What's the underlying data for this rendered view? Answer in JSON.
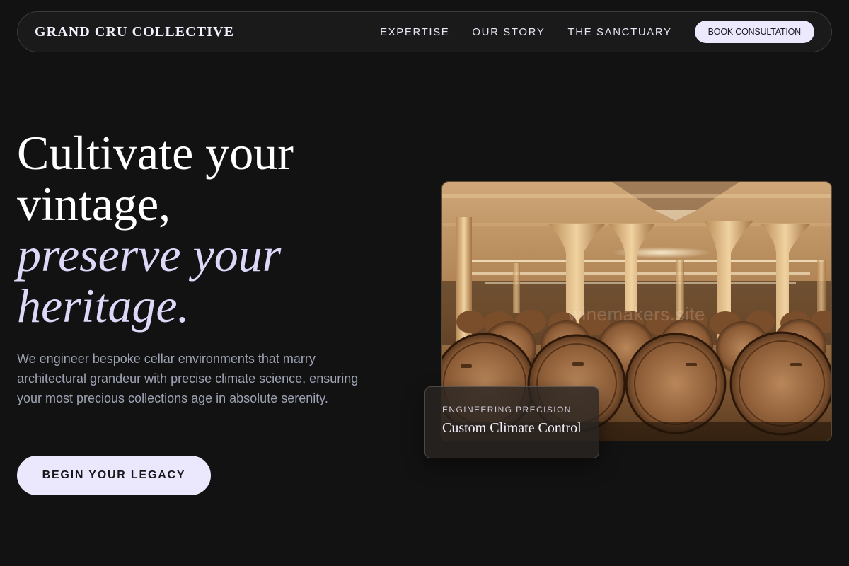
{
  "nav": {
    "brand": "GRAND CRU COLLECTIVE",
    "links": [
      {
        "label": "EXPERTISE"
      },
      {
        "label": "OUR STORY"
      },
      {
        "label": "THE SANCTUARY"
      }
    ],
    "cta": "BOOK CONSULTATION"
  },
  "hero": {
    "title_line1": "Cultivate your",
    "title_line2": "vintage,",
    "title_line3": "preserve your",
    "title_line4": "heritage.",
    "description": "We engineer bespoke cellar environments that marry architectural grandeur with precise climate science, ensuring your most precious collections age in absolute serenity.",
    "cta": "BEGIN YOUR LEGACY"
  },
  "image": {
    "watermark": "winemakers.site"
  },
  "badge": {
    "kicker": "ENGINEERING PRECISION",
    "title": "Custom Climate Control"
  },
  "colors": {
    "background": "#121212",
    "accent": "#ECE9FF",
    "muted_text": "#9EA3B3"
  }
}
